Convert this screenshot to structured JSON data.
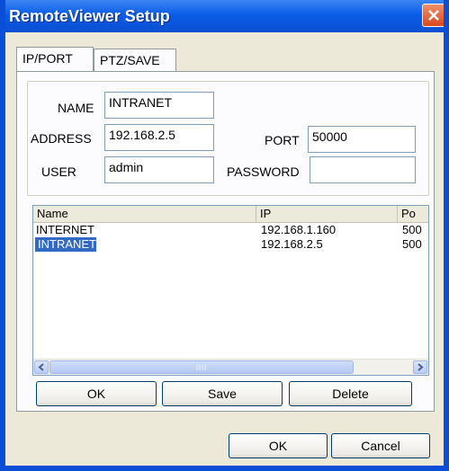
{
  "window": {
    "title": "RemoteViewer Setup"
  },
  "tabs": [
    {
      "label": "IP/PORT"
    },
    {
      "label": "PTZ/SAVE"
    }
  ],
  "form": {
    "name_label": "NAME",
    "name_value": "INTRANET",
    "address_label": "ADDRESS",
    "address_value": "192.168.2.5",
    "port_label": "PORT",
    "port_value": "50000",
    "user_label": "USER",
    "user_value": "admin",
    "password_label": "PASSWORD",
    "password_value": ""
  },
  "list": {
    "columns": [
      "Name",
      "IP",
      "Po"
    ],
    "rows": [
      {
        "name": "INTERNET",
        "ip": "192.168.1.160",
        "port": "500",
        "selected": false
      },
      {
        "name": "INTRANET",
        "ip": "192.168.2.5",
        "port": "500",
        "selected": true
      }
    ]
  },
  "list_buttons": {
    "ok": "OK",
    "save": "Save",
    "delete": "Delete"
  },
  "dialog_buttons": {
    "ok": "OK",
    "cancel": "Cancel"
  },
  "colors": {
    "titlebar": "#0b5ce8",
    "selection": "#316ac5",
    "close": "#d8471c"
  },
  "icons": {
    "close": "close-icon",
    "scroll_left": "arrow-left-icon",
    "scroll_right": "arrow-right-icon"
  }
}
